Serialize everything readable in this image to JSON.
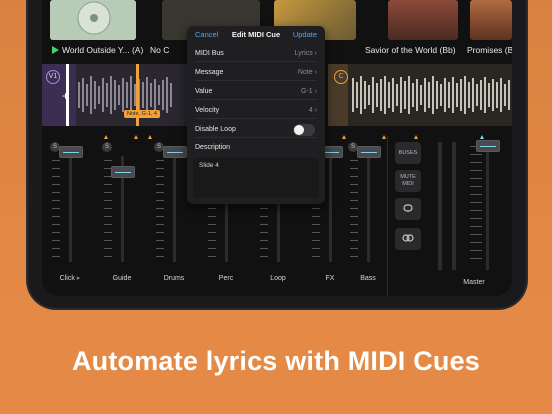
{
  "caption": "Automate lyrics with MIDI Cues",
  "songs": [
    {
      "title": "World Outside Y...",
      "key": "(A)",
      "playing": true
    },
    {
      "title": "No C",
      "key": "",
      "playing": false
    },
    {
      "title": "Savior of the World (Bb)",
      "key": "",
      "playing": false
    },
    {
      "title": "Promises (Bb",
      "key": "",
      "playing": false
    }
  ],
  "markers": {
    "v1": "V1",
    "c": "C"
  },
  "cue_tag": "Note, G-1, 4",
  "panel": {
    "cancel": "Cancel",
    "title": "Edit MIDI Cue",
    "update": "Update",
    "rows": [
      {
        "label": "MIDI Bus",
        "value": "Lyrics"
      },
      {
        "label": "Message",
        "value": "Note"
      },
      {
        "label": "Value",
        "value": "G-1"
      },
      {
        "label": "Velocity",
        "value": "4"
      }
    ],
    "disable_loop": "Disable Loop",
    "disable_loop_on": false,
    "description_label": "Description",
    "description_value": "Slide 4"
  },
  "mixer": {
    "strips": [
      {
        "label": "Click",
        "solo": "S"
      },
      {
        "label": "Guide",
        "solo": "S"
      },
      {
        "label": "Drums",
        "solo": "S"
      },
      {
        "label": "Perc",
        "solo": "S"
      },
      {
        "label": "Loop",
        "solo": "S"
      },
      {
        "label": "FX",
        "solo": "S"
      },
      {
        "label": "Bass",
        "solo": "S"
      }
    ],
    "buses": "BUSES",
    "mute_midi": "MUTE MIDI",
    "master": "Master"
  },
  "colors": {
    "accent_blue": "#5aa3f0",
    "play_green": "#4ad06b",
    "cue_orange": "#f0a13a",
    "fader_line": "#7fd3e3"
  }
}
